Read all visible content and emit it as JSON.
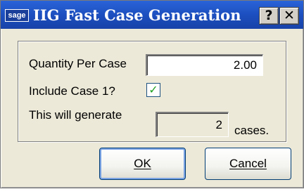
{
  "titlebar": {
    "brand": "sage",
    "title": "IIG Fast Case Generation",
    "help_label": "?",
    "close_label": "✕"
  },
  "form": {
    "quantity_label": "Quantity Per Case",
    "quantity_value": "2.00",
    "include_label": "Include Case 1?",
    "include_checked": true,
    "include_mark": "✓",
    "generate_label": "This will generate",
    "generate_value": "2",
    "cases_label": "cases."
  },
  "buttons": {
    "ok_label": "OK",
    "cancel_label": "Cancel"
  }
}
